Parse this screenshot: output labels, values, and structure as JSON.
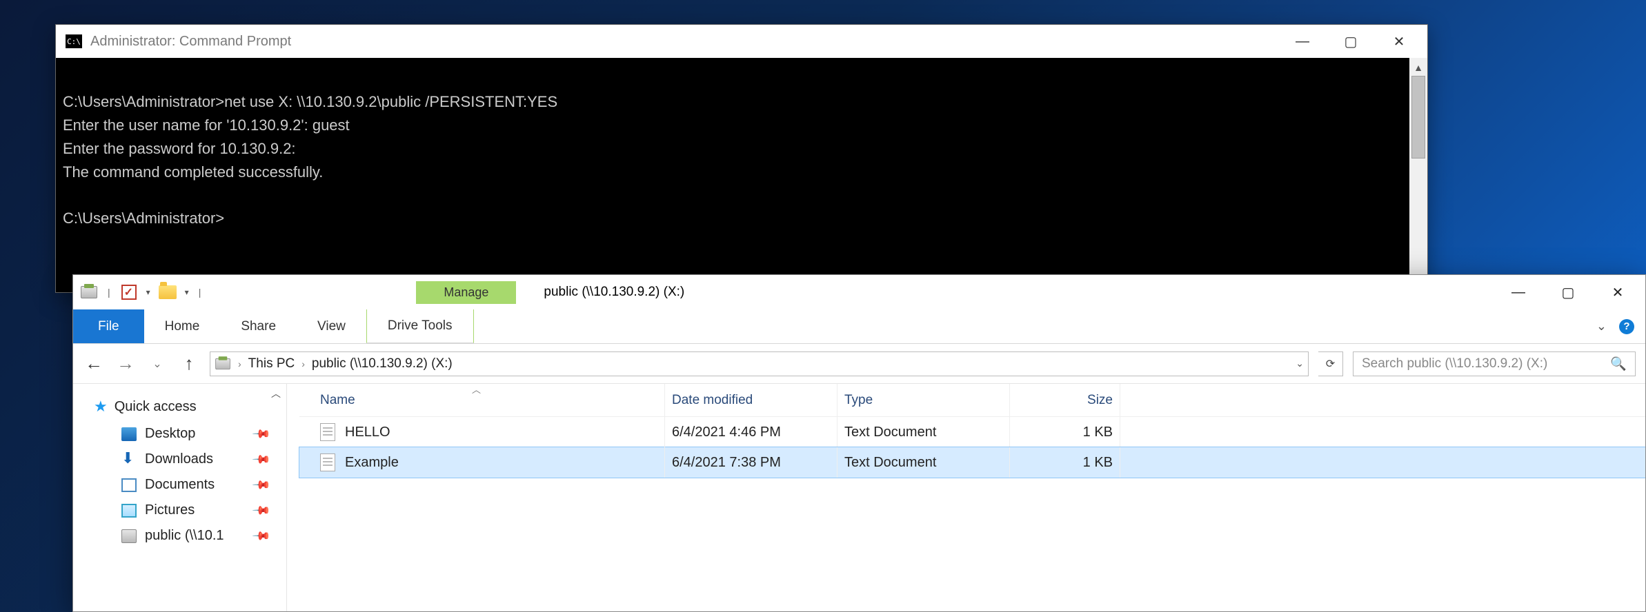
{
  "cmd": {
    "title": "Administrator: Command Prompt",
    "lines": "C:\\Users\\Administrator>net use X: \\\\10.130.9.2\\public /PERSISTENT:YES\nEnter the user name for '10.130.9.2': guest\nEnter the password for 10.130.9.2:\nThe command completed successfully.\n\nC:\\Users\\Administrator>"
  },
  "explorer": {
    "context_tab": "Manage",
    "context_group": "Drive Tools",
    "title": "public (\\\\10.130.9.2) (X:)",
    "ribbon": {
      "file": "File",
      "home": "Home",
      "share": "Share",
      "view": "View"
    },
    "breadcrumb": {
      "root": "This PC",
      "loc": "public (\\\\10.130.9.2) (X:)"
    },
    "search_placeholder": "Search public (\\\\10.130.9.2) (X:)",
    "nav": {
      "quick": "Quick access",
      "items": [
        {
          "label": "Desktop"
        },
        {
          "label": "Downloads"
        },
        {
          "label": "Documents"
        },
        {
          "label": "Pictures"
        },
        {
          "label": "public (\\\\10.1"
        }
      ]
    },
    "columns": {
      "name": "Name",
      "date": "Date modified",
      "type": "Type",
      "size": "Size"
    },
    "files": [
      {
        "name": "HELLO",
        "date": "6/4/2021 4:46 PM",
        "type": "Text Document",
        "size": "1 KB",
        "selected": false
      },
      {
        "name": "Example",
        "date": "6/4/2021 7:38 PM",
        "type": "Text Document",
        "size": "1 KB",
        "selected": true
      }
    ]
  }
}
